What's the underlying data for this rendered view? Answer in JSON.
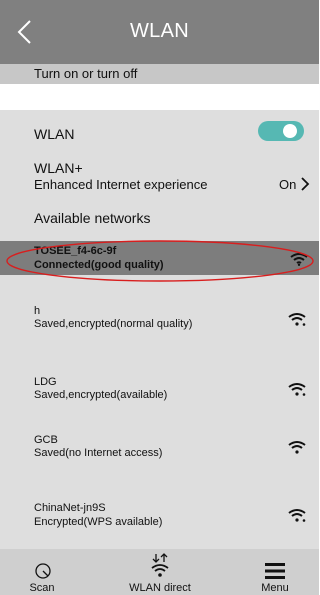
{
  "header": {
    "title": "WLAN"
  },
  "hint": "Turn on or turn off",
  "wlan_toggle": {
    "label": "WLAN",
    "state": "on"
  },
  "wlan_plus": {
    "title": "WLAN+",
    "subtitle": "Enhanced Internet experience",
    "value": "On"
  },
  "available_header": "Available networks",
  "connected": {
    "name": "TOSEE_f4-6c-9f",
    "status": "Connected(good quality)"
  },
  "networks": [
    {
      "name": "h",
      "status": "Saved,encrypted(normal quality)"
    },
    {
      "name": "LDG",
      "status": "Saved,encrypted(available)"
    },
    {
      "name": "GCB",
      "status": "Saved(no Internet access)"
    },
    {
      "name": "ChinaNet-jn9S",
      "status": "Encrypted(WPS available)"
    }
  ],
  "bottom": {
    "scan": "Scan",
    "direct": "WLAN direct",
    "menu": "Menu"
  },
  "colors": {
    "header": "#808080",
    "accent": "#56b8b3",
    "highlight_oval": "#d81e1e"
  }
}
